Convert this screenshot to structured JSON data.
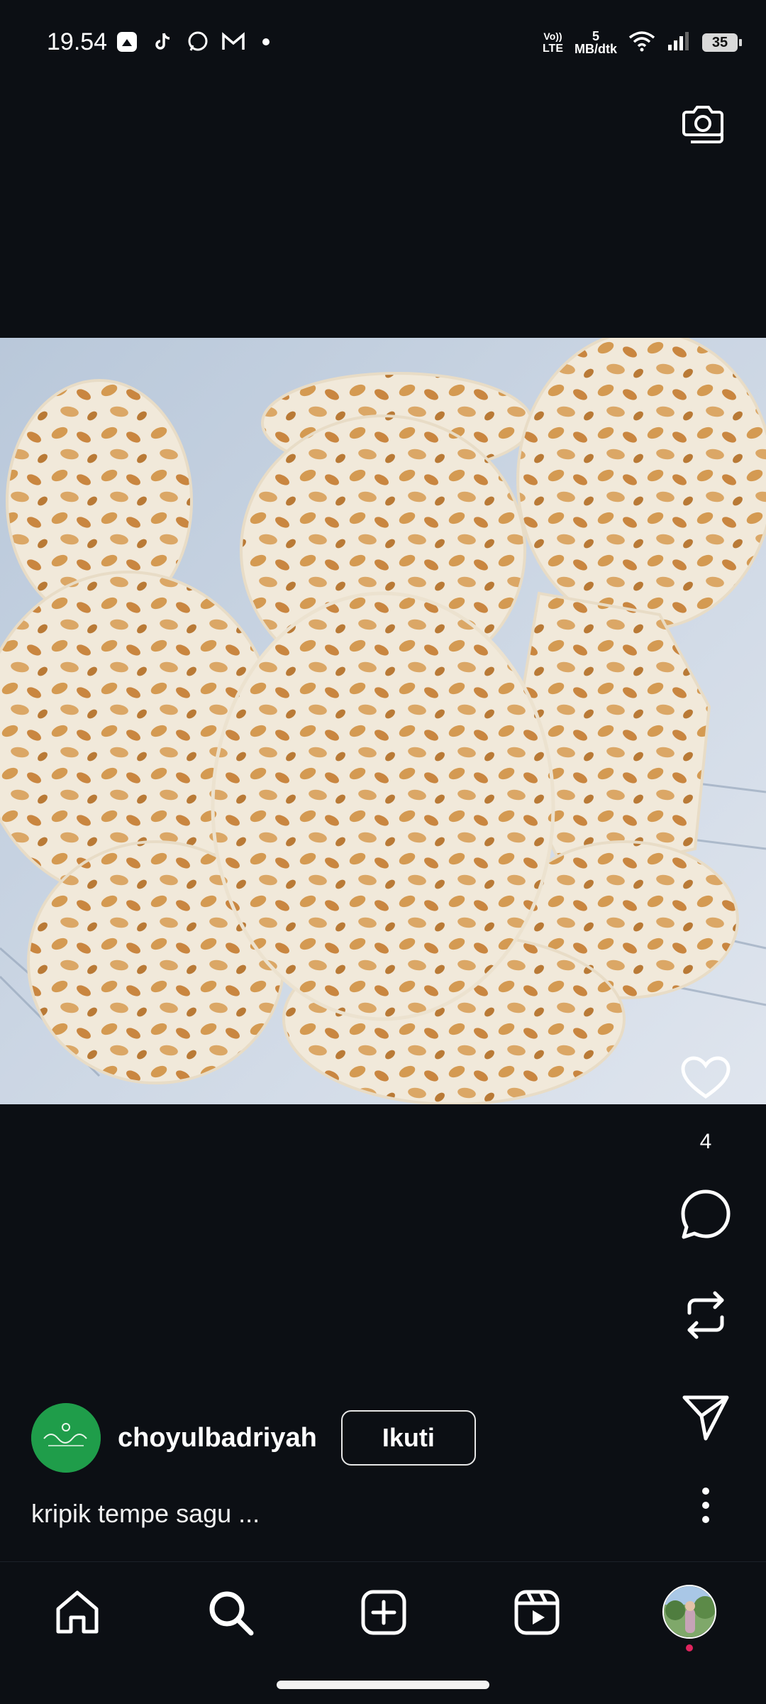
{
  "status_bar": {
    "time": "19.54",
    "network_top": "Vo))",
    "network_bottom": "LTE",
    "speed_value": "5",
    "speed_unit": "MB/dtk",
    "battery": "35",
    "app_icons": [
      "photo-app-icon",
      "tiktok-icon",
      "whatsapp-icon",
      "gmail-icon",
      "dot-icon"
    ]
  },
  "post": {
    "image_icon": "food-photo",
    "likes": "4"
  },
  "author": {
    "username": "choyulbadriyah",
    "follow_label": "Ikuti"
  },
  "caption": "kripik tempe sagu ...",
  "bottom_nav": {
    "items": [
      "home-icon",
      "search-icon",
      "create-icon",
      "reels-icon",
      "profile-avatar"
    ]
  },
  "colors": {
    "background": "#0c0f14",
    "text": "#ffffff",
    "notification_dot": "#e0245e",
    "avatar_bg": "#1f9d4a"
  }
}
